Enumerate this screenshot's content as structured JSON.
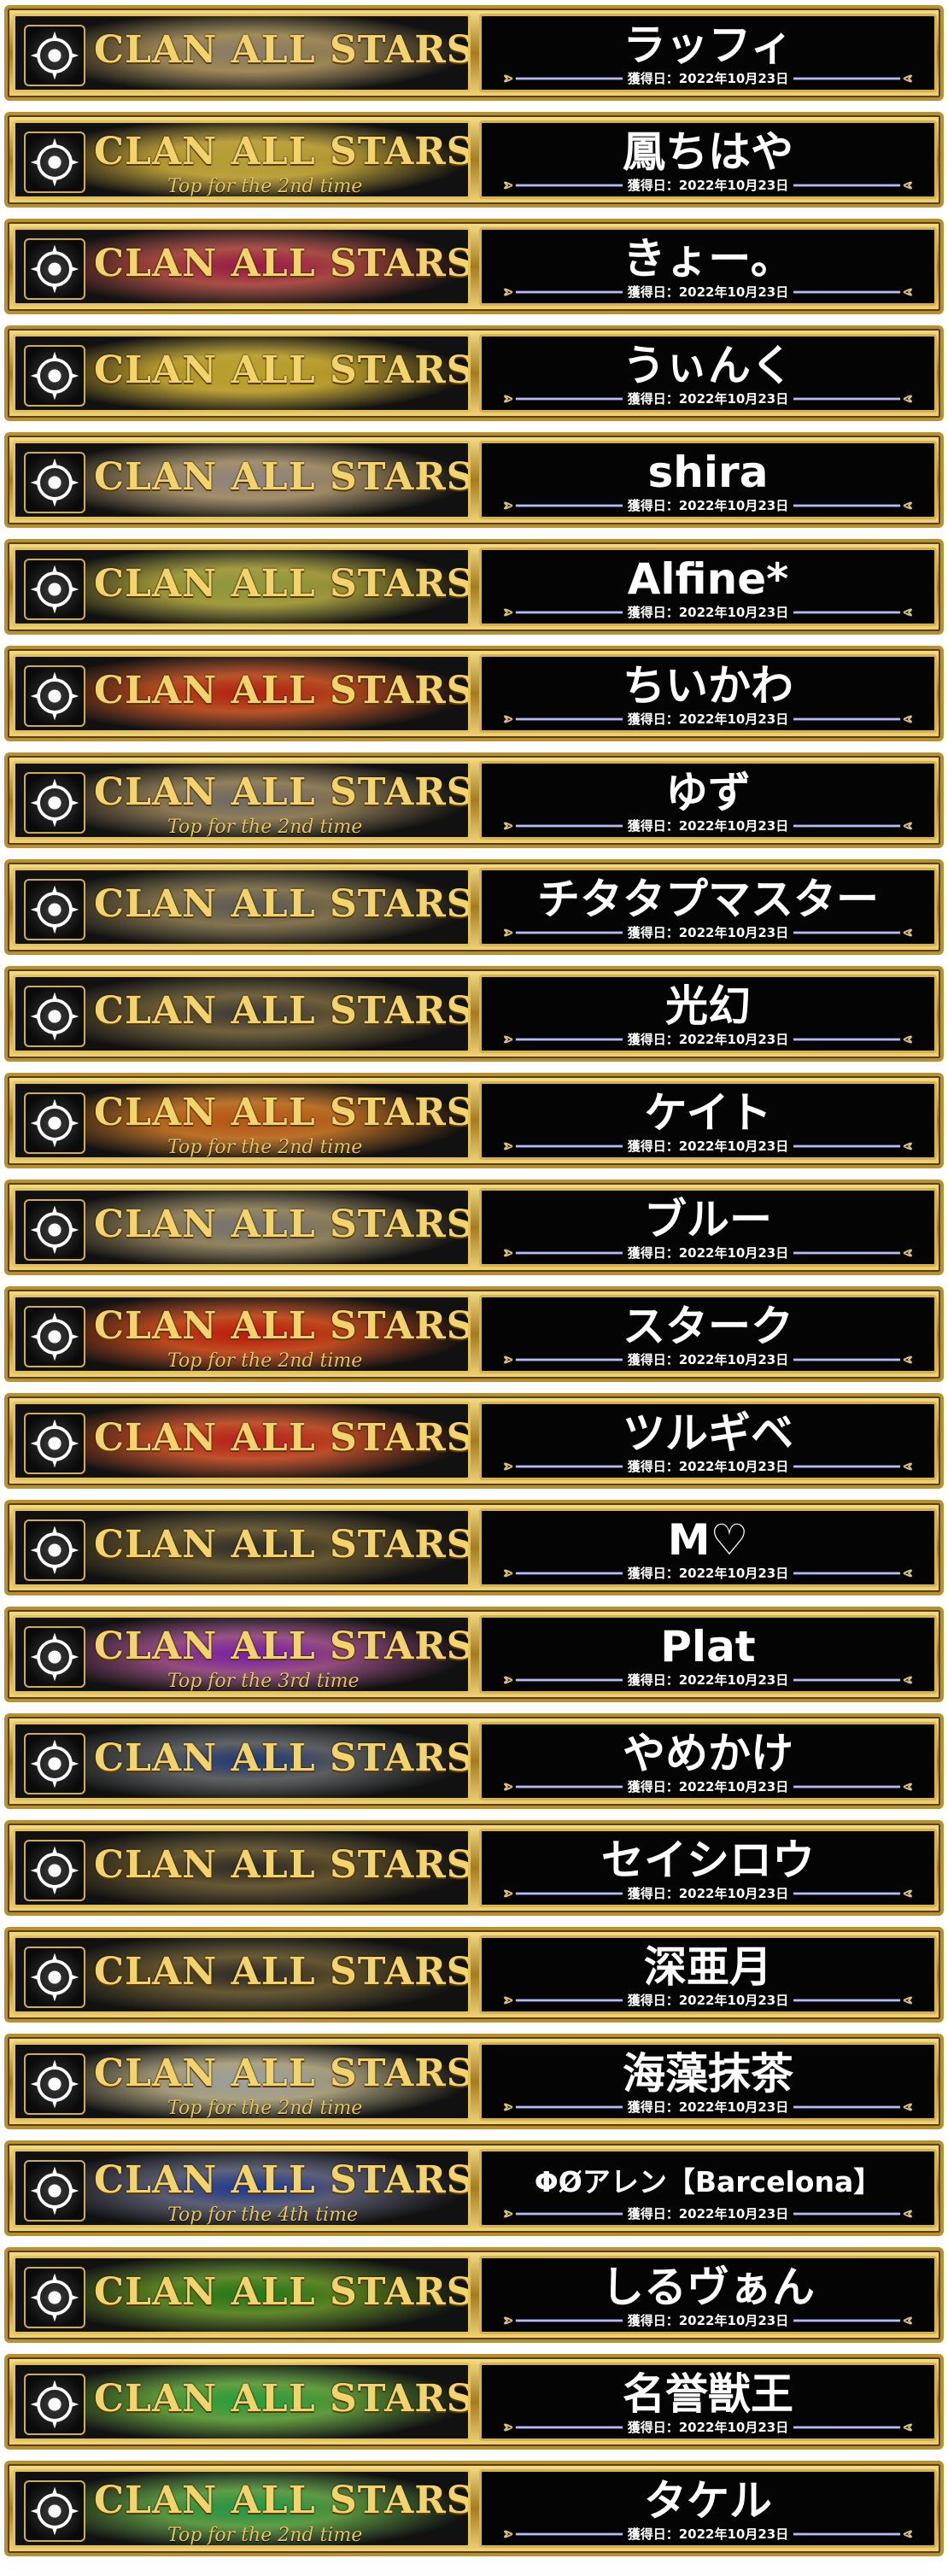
{
  "banner_title": "CLAN ALL STARS",
  "acquired_label": "獲得日：",
  "entries": [
    {
      "name": "ラッフィ",
      "date": "2022年10月23日",
      "subtitle": "",
      "color": "#8a7d6a",
      "emblem": "ring-sun-emblem-icon"
    },
    {
      "name": "鳳ちはや",
      "date": "2022年10月23日",
      "subtitle": "Top for the 2nd time",
      "color": "#b7a23a",
      "emblem": "cross-knot-emblem-icon"
    },
    {
      "name": "きょー。",
      "date": "2022年10月23日",
      "subtitle": "",
      "color": "#9a1a4a",
      "emblem": "wing-star-emblem-icon"
    },
    {
      "name": "うぃんく",
      "date": "2022年10月23日",
      "subtitle": "",
      "color": "#b9a32e",
      "emblem": "compass-cross-emblem-icon"
    },
    {
      "name": "shira",
      "date": "2022年10月23日",
      "subtitle": "",
      "color": "#8f8585",
      "emblem": "feather-emblem-icon"
    },
    {
      "name": "Alfine*",
      "date": "2022年10月23日",
      "subtitle": "",
      "color": "#8e9a40",
      "emblem": "infinity-moon-emblem-icon"
    },
    {
      "name": "ちいかわ",
      "date": "2022年10月23日",
      "subtitle": "",
      "color": "#b42016",
      "emblem": "crown-flame-emblem-icon"
    },
    {
      "name": "ゆず",
      "date": "2022年10月23日",
      "subtitle": "Top for the 2nd time",
      "color": "#6f6a6a",
      "emblem": "hex-mask-emblem-icon"
    },
    {
      "name": "チタタプマスター",
      "date": "2022年10月23日",
      "subtitle": "",
      "color": "#5a5a5a",
      "emblem": "orb-wing-emblem-icon"
    },
    {
      "name": "光幻",
      "date": "2022年10月23日",
      "subtitle": "",
      "color": "#3a3a3a",
      "emblem": "flame-swirl-emblem-icon"
    },
    {
      "name": "ケイト",
      "date": "2022年10月23日",
      "subtitle": "Top for the 2nd time",
      "color": "#b8561a",
      "emblem": "spiky-star-emblem-icon"
    },
    {
      "name": "ブルー",
      "date": "2022年10月23日",
      "subtitle": "",
      "color": "#747474",
      "emblem": "horned-helm-emblem-icon"
    },
    {
      "name": "スターク",
      "date": "2022年10月23日",
      "subtitle": "Top for the 2nd time",
      "color": "#c01a10",
      "emblem": "snowflake-mask-emblem-icon"
    },
    {
      "name": "ツルギベ",
      "date": "2022年10月23日",
      "subtitle": "",
      "color": "#bc1f1f",
      "emblem": "atom-emblem-icon"
    },
    {
      "name": "M♡",
      "date": "2022年10月23日",
      "subtitle": "",
      "color": "#2d2d2d",
      "emblem": "claw-mask-emblem-icon"
    },
    {
      "name": "Plat",
      "date": "2022年10月23日",
      "subtitle": "Top for the 3rd time",
      "color": "#7a1eb0",
      "emblem": "snowflake-emblem-icon"
    },
    {
      "name": "やめかけ",
      "date": "2022年10月23日",
      "subtitle": "",
      "color": "#1d3a7a",
      "emblem": "beast-emblem-icon"
    },
    {
      "name": "セイシロウ",
      "date": "2022年10月23日",
      "subtitle": "",
      "color": "#2a2a2a",
      "emblem": "dice-emblem-icon"
    },
    {
      "name": "深亜月",
      "date": "2022年10月23日",
      "subtitle": "",
      "color": "#2a2a2a",
      "emblem": "mask-emblem-icon"
    },
    {
      "name": "海藻抹茶",
      "date": "2022年10月23日",
      "subtitle": "Top for the 2nd time",
      "color": "#9aa3a8",
      "emblem": "gem-diamond-emblem-icon"
    },
    {
      "name": "ΦØアレン【Barcelona】",
      "date": "2022年10月23日",
      "subtitle": "Top for the 4th time",
      "color": "#1c3a9a",
      "emblem": "radiant-star-emblem-icon"
    },
    {
      "name": "しるヴぁん",
      "date": "2022年10月23日",
      "subtitle": "",
      "color": "#1f7a1a",
      "emblem": "twin-blade-emblem-icon"
    },
    {
      "name": "名誉獣王",
      "date": "2022年10月23日",
      "subtitle": "",
      "color": "#24a040",
      "emblem": "x-diamond-emblem-icon"
    },
    {
      "name": "タケル",
      "date": "2022年10月23日",
      "subtitle": "Top for the 2nd time",
      "color": "#1e9a4a",
      "emblem": "hexagon-flower-emblem-icon"
    }
  ]
}
